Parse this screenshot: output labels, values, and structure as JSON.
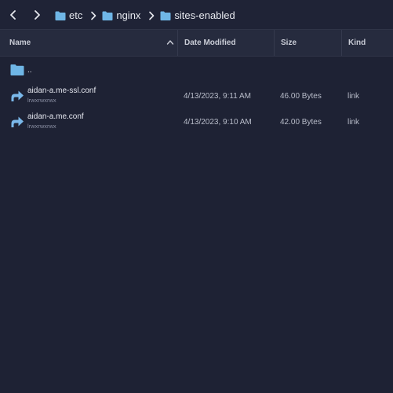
{
  "toolbar": {
    "back_icon": "chevron-left-icon",
    "forward_icon": "chevron-right-icon",
    "breadcrumb": [
      {
        "label": "etc",
        "icon": "folder-icon"
      },
      {
        "label": "nginx",
        "icon": "folder-icon"
      },
      {
        "label": "sites-enabled",
        "icon": "folder-icon"
      }
    ]
  },
  "columns": {
    "name": "Name",
    "date": "Date Modified",
    "size": "Size",
    "kind": "Kind",
    "sort_icon": "caret-up-icon"
  },
  "rows": [
    {
      "name": "..",
      "icon": "folder-icon",
      "perm": "",
      "date": "",
      "size": "",
      "kind": ""
    },
    {
      "name": "aidan-a.me-ssl.conf",
      "icon": "symlink-arrow-icon",
      "perm": "lrwxrwxrwx",
      "date": "4/13/2023, 9:11 AM",
      "size": "46.00 Bytes",
      "kind": "link"
    },
    {
      "name": "aidan-a.me.conf",
      "icon": "symlink-arrow-icon",
      "perm": "lrwxrwxrwx",
      "date": "4/13/2023, 9:10 AM",
      "size": "42.00 Bytes",
      "kind": "link"
    }
  ],
  "colors": {
    "background": "#1e2234",
    "header": "#262b3e",
    "folder": "#6fb6e6",
    "link_arrow": "#7ab8ea"
  }
}
